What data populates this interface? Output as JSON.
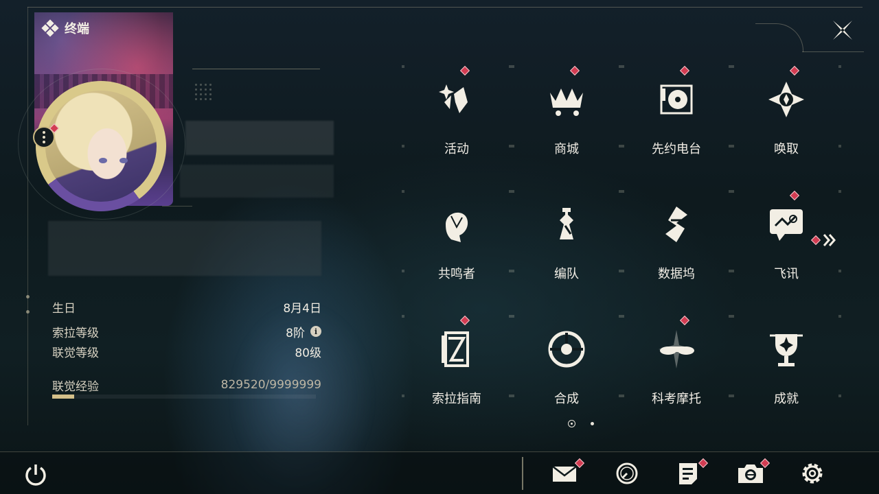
{
  "header": {
    "title": "终端"
  },
  "profile": {
    "stats": [
      {
        "label": "生日",
        "value": "8月4日"
      },
      {
        "label": "索拉等级",
        "value": "8阶",
        "info_icon": "info-icon"
      },
      {
        "label": "联觉等级",
        "value": "80级"
      },
      {
        "label": "联觉经验",
        "value": "829520/9999999",
        "progress": 0.083
      }
    ]
  },
  "menu": {
    "page": 1,
    "page_count": 2,
    "items": [
      {
        "label": "活动",
        "icon": "sparkle-event-icon",
        "badge": true
      },
      {
        "label": "商城",
        "icon": "shopping-cart-crown-icon",
        "badge": true
      },
      {
        "label": "先约电台",
        "icon": "radio-turntable-icon",
        "badge": true
      },
      {
        "label": "唤取",
        "icon": "compass-star-icon",
        "badge": true
      },
      {
        "label": "共鸣者",
        "icon": "character-head-icon",
        "badge": false
      },
      {
        "label": "编队",
        "icon": "chess-team-icon",
        "badge": false
      },
      {
        "label": "数据坞",
        "icon": "data-dock-icon",
        "badge": false
      },
      {
        "label": "飞讯",
        "icon": "message-bubble-icon",
        "badge": true
      },
      {
        "label": "索拉指南",
        "icon": "guide-book-icon",
        "badge": true
      },
      {
        "label": "合成",
        "icon": "synthesis-icon",
        "badge": false
      },
      {
        "label": "科考摩托",
        "icon": "motorbike-icon",
        "badge": true
      },
      {
        "label": "成就",
        "icon": "trophy-icon",
        "badge": false
      }
    ]
  },
  "bottom_bar": {
    "power": "power-icon",
    "icons": [
      {
        "name": "mail-icon",
        "badge": true
      },
      {
        "name": "clock-icon",
        "badge": false
      },
      {
        "name": "notes-icon",
        "badge": true
      },
      {
        "name": "camera-icon",
        "badge": true
      },
      {
        "name": "settings-gear-icon",
        "badge": false
      }
    ]
  },
  "colors": {
    "accent_gold": "#d3c08a",
    "badge_red": "#d23c52",
    "background": "#0f1a1d"
  }
}
